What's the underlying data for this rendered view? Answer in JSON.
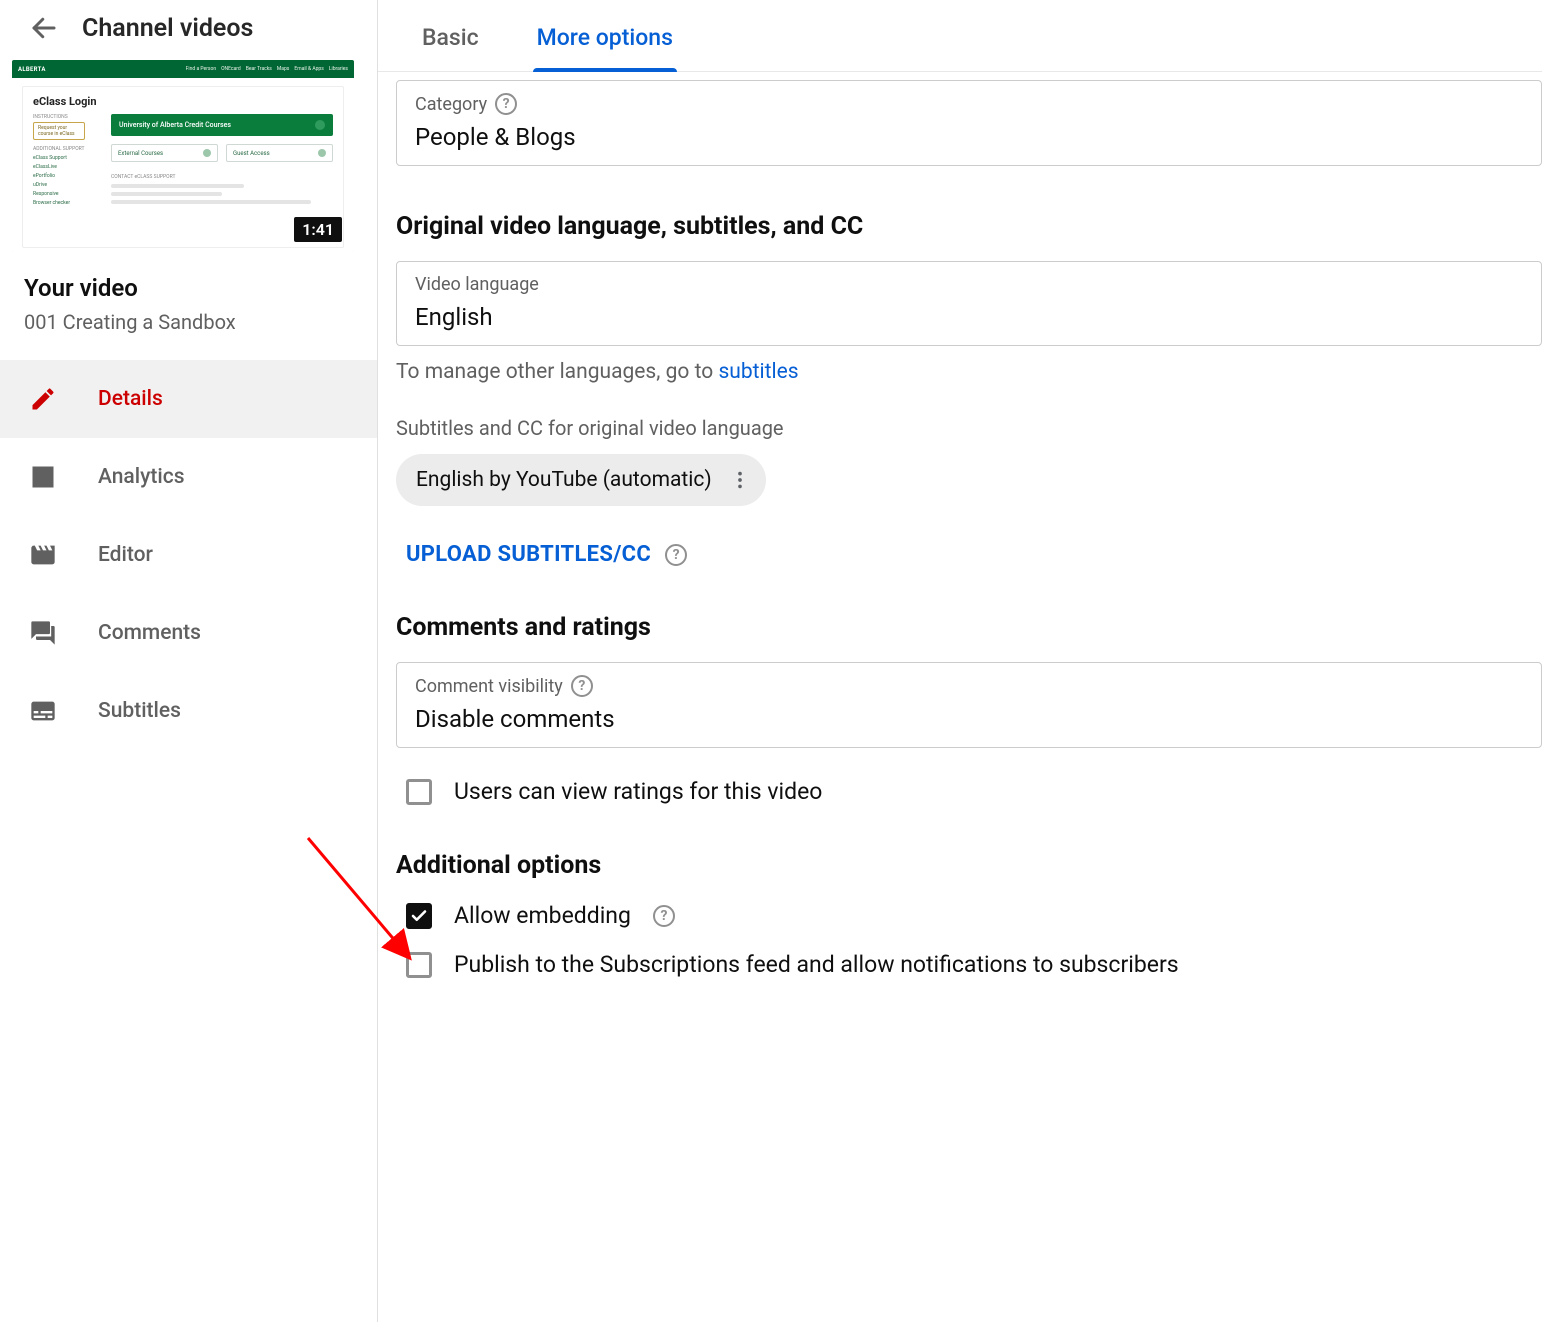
{
  "sidebar": {
    "back_title": "Channel videos",
    "thumb": {
      "logo": "ALBERTA",
      "nav": [
        "Find a Person",
        "ONEcard",
        "Bear Tracks",
        "Maps",
        "Email & Apps",
        "Libraries"
      ],
      "panel_title": "eClass Login",
      "instructions_heading": "INSTRUCTIONS",
      "request_text": "Request your course in eClass",
      "primary_btn": "University of Alberta Credit Courses",
      "secondary_a": "External Courses",
      "secondary_b": "Guest Access",
      "additional_heading": "ADDITIONAL SUPPORT",
      "support_items": [
        "eClass Support",
        "eClassLive",
        "ePortfolio",
        "uDrive",
        "Responsive",
        "Browser checker"
      ],
      "contact_heading": "CONTACT eCLASS SUPPORT",
      "duration": "1:41"
    },
    "your_video_heading": "Your video",
    "video_title": "001 Creating a Sandbox",
    "nav": [
      {
        "key": "details",
        "label": "Details"
      },
      {
        "key": "analytics",
        "label": "Analytics"
      },
      {
        "key": "editor",
        "label": "Editor"
      },
      {
        "key": "comments",
        "label": "Comments"
      },
      {
        "key": "subtitles",
        "label": "Subtitles"
      }
    ]
  },
  "tabs": {
    "basic": "Basic",
    "more": "More options"
  },
  "category": {
    "label": "Category",
    "value": "People & Blogs"
  },
  "lang_section": {
    "heading": "Original video language, subtitles, and CC",
    "field_label": "Video language",
    "field_value": "English",
    "hint_pre": "To manage other languages, go to ",
    "hint_link": "subtitles",
    "sub_label": "Subtitles and CC for original video language",
    "chip": "English by YouTube (automatic)",
    "upload": "UPLOAD SUBTITLES/CC"
  },
  "comments_section": {
    "heading": "Comments and ratings",
    "field_label": "Comment visibility",
    "field_value": "Disable comments",
    "ratings_check": "Users can view ratings for this video"
  },
  "additional": {
    "heading": "Additional options",
    "embed": "Allow embedding",
    "publish": "Publish to the Subscriptions feed and allow notifications to subscribers"
  }
}
